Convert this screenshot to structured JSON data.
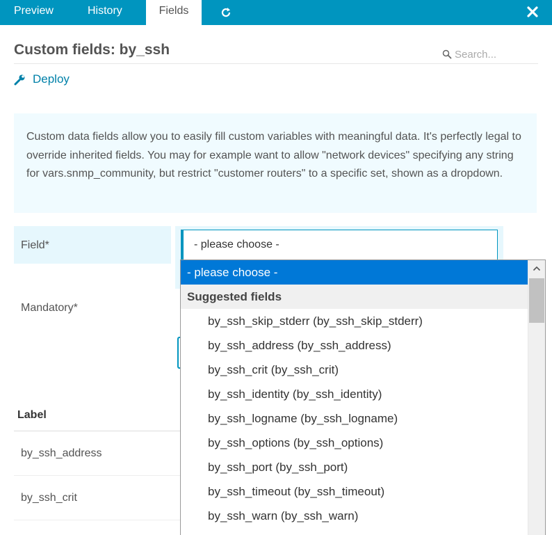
{
  "tabs": {
    "preview": "Preview",
    "history": "History",
    "fields": "Fields"
  },
  "header": {
    "title": "Custom fields: by_ssh",
    "search_placeholder": "Search..."
  },
  "deploy": {
    "label": "Deploy"
  },
  "info": {
    "text": "Custom data fields allow you to easily fill custom variables with meaningful data. It's perfectly legal to override inherited fields. You may for example want to allow \"network devices\" specifying any string for vars.snmp_community, but restrict \"customer routers\" to a specific set, shown as a dropdown."
  },
  "form": {
    "field_label": "Field*",
    "field_value": "- please choose -",
    "mandatory_label": "Mandatory*"
  },
  "dropdown": {
    "selected": "- please choose -",
    "group": "Suggested fields",
    "options": [
      "by_ssh_skip_stderr (by_ssh_skip_stderr)",
      "by_ssh_address (by_ssh_address)",
      "by_ssh_crit (by_ssh_crit)",
      "by_ssh_identity (by_ssh_identity)",
      "by_ssh_logname (by_ssh_logname)",
      "by_ssh_options (by_ssh_options)",
      "by_ssh_port (by_ssh_port)",
      "by_ssh_timeout (by_ssh_timeout)",
      "by_ssh_warn (by_ssh_warn)"
    ]
  },
  "table": {
    "header_label": "Label",
    "rows": [
      "by_ssh_address",
      "by_ssh_crit"
    ]
  },
  "icons": {
    "refresh": "refresh-icon",
    "close": "close-icon",
    "search": "search-icon",
    "wrench": "wrench-icon",
    "scroll_up": "chevron-up-icon"
  },
  "colors": {
    "accent": "#0095bf",
    "link": "#0081a9",
    "selected_option": "#0078d7",
    "info_bg": "#f0fbff"
  }
}
